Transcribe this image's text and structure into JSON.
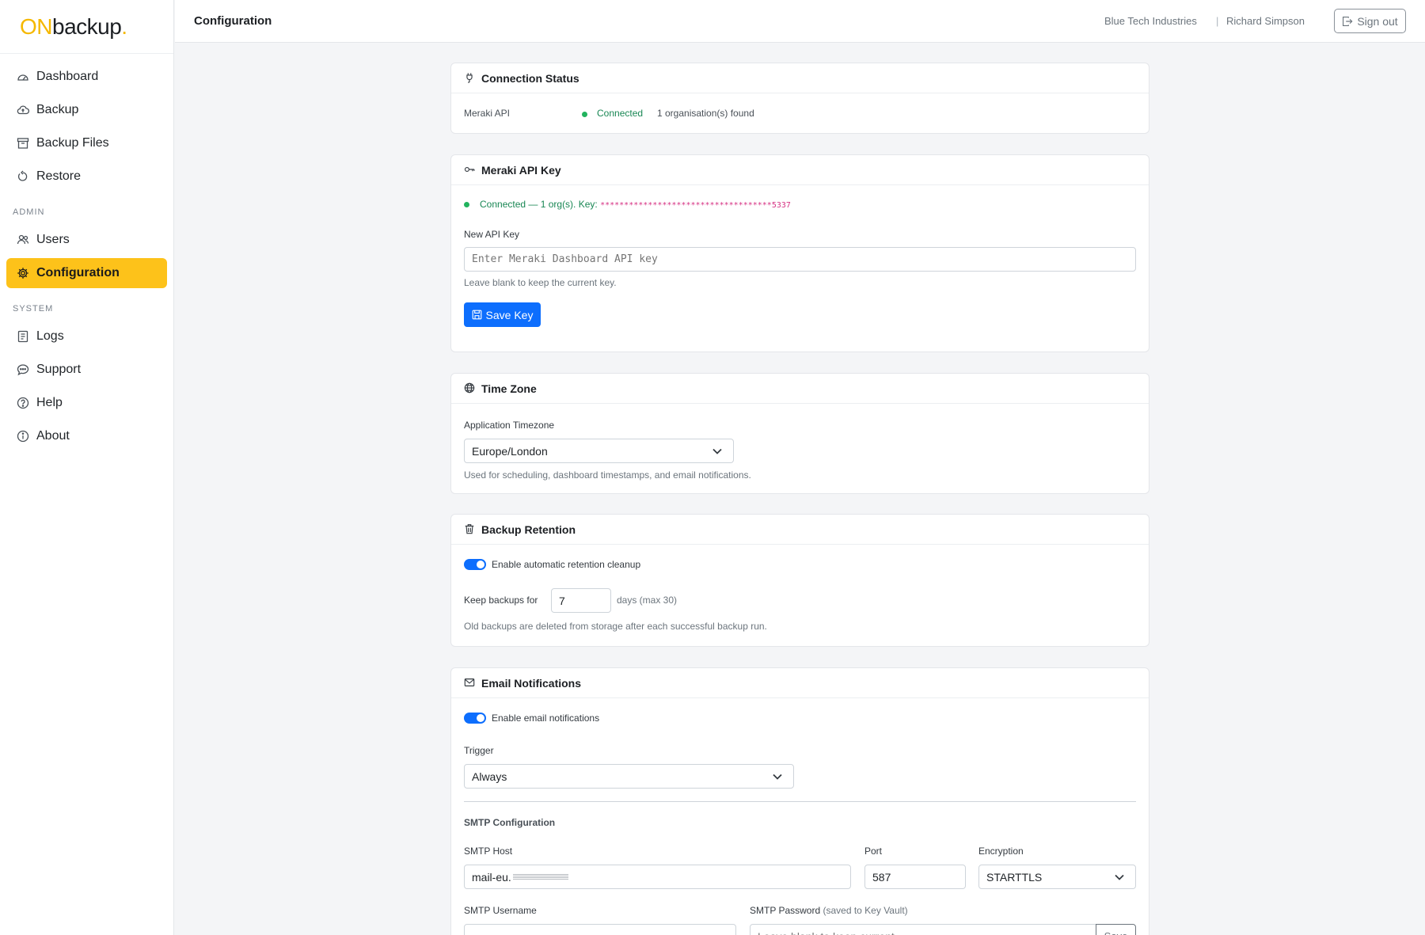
{
  "brand": {
    "on": "ON",
    "backup": "backup",
    "dot": "."
  },
  "sidebar": {
    "items": [
      {
        "label": "Dashboard",
        "icon": "dashboard-gauge-icon"
      },
      {
        "label": "Backup",
        "icon": "cloud-upload-icon"
      },
      {
        "label": "Backup Files",
        "icon": "archive-box-icon"
      },
      {
        "label": "Restore",
        "icon": "restore-arrow-icon"
      }
    ],
    "admin_section": "ADMIN",
    "admin_items": [
      {
        "label": "Users",
        "icon": "users-icon"
      },
      {
        "label": "Configuration",
        "icon": "gear-icon",
        "active": true
      }
    ],
    "system_section": "SYSTEM",
    "system_items": [
      {
        "label": "Logs",
        "icon": "journal-icon"
      },
      {
        "label": "Support",
        "icon": "chat-bubble-icon"
      },
      {
        "label": "Help",
        "icon": "question-circle-icon"
      },
      {
        "label": "About",
        "icon": "info-circle-icon"
      }
    ]
  },
  "topbar": {
    "title": "Configuration",
    "org": "Blue Tech Industries",
    "separator": "|",
    "user": "Richard Simpson",
    "signout": "Sign out"
  },
  "connection": {
    "title": "Connection Status",
    "label": "Meraki API",
    "status": "Connected",
    "detail": "1 organisation(s) found"
  },
  "apikey": {
    "title": "Meraki API Key",
    "status_prefix": "Connected — 1 org(s). Key: ",
    "masked_key": "************************************5337",
    "field_label": "New API Key",
    "placeholder": "Enter Meraki Dashboard API key",
    "help": "Leave blank to keep the current key.",
    "save_button": "Save Key"
  },
  "timezone": {
    "title": "Time Zone",
    "field_label": "Application Timezone",
    "value": "Europe/London",
    "help": "Used for scheduling, dashboard timestamps, and email notifications."
  },
  "retention": {
    "title": "Backup Retention",
    "toggle_label": "Enable automatic retention cleanup",
    "enabled": true,
    "keep_label": "Keep backups for",
    "days": "7",
    "days_suffix": "days (max 30)",
    "help": "Old backups are deleted from storage after each successful backup run."
  },
  "email": {
    "title": "Email Notifications",
    "toggle_label": "Enable email notifications",
    "enabled": true,
    "trigger_label": "Trigger",
    "trigger_value": "Always",
    "smtp_section": "SMTP Configuration",
    "host_label": "SMTP Host",
    "host_value": "mail-eu.",
    "port_label": "Port",
    "port_value": "587",
    "encryption_label": "Encryption",
    "encryption_value": "STARTTLS",
    "username_label": "SMTP Username",
    "password_label": "SMTP Password",
    "password_note": "(saved to Key Vault)",
    "password_placeholder": "Leave blank to keep current",
    "password_save": "Save"
  },
  "colors": {
    "accent": "#fdc21a",
    "primary": "#0d6efd",
    "success": "#22b35e",
    "masked_key": "#d63384"
  }
}
